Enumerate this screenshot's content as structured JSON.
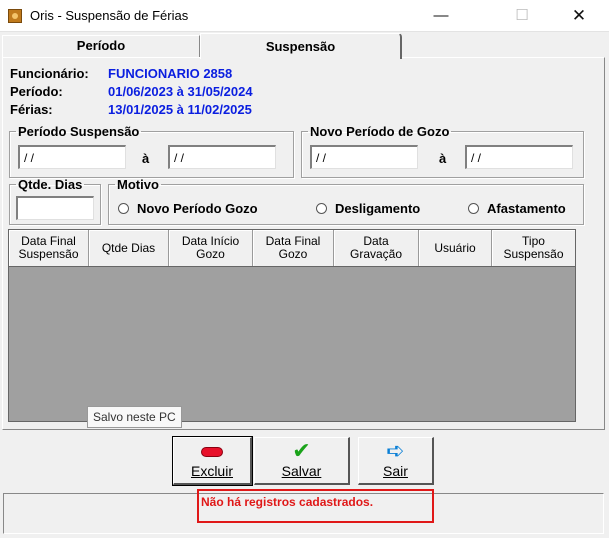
{
  "window": {
    "title": "Oris - Suspensão de Férias",
    "min_symbol": "—",
    "max_symbol": "☐",
    "close_symbol": "✕"
  },
  "tabs": [
    {
      "label": "Período"
    },
    {
      "label": "Suspensão"
    }
  ],
  "info": {
    "funcionario_label": "Funcionário:",
    "funcionario_value": "FUNCIONARIO 2858",
    "periodo_label": "Período:",
    "periodo_value": "01/06/2023 à 31/05/2024",
    "ferias_label": "Férias:",
    "ferias_value": "13/01/2025 à 11/02/2025"
  },
  "periodo_suspensao": {
    "legend": "Período Suspensão",
    "start_value": "/ /",
    "separator": "à",
    "end_value": "/ /"
  },
  "novo_periodo_gozo": {
    "legend": "Novo Período de Gozo",
    "start_value": "/ /",
    "separator": "à",
    "end_value": "/ /"
  },
  "qtde_dias": {
    "legend": "Qtde. Dias",
    "value": ""
  },
  "motivo": {
    "legend": "Motivo",
    "options": [
      {
        "label": "Novo Período Gozo"
      },
      {
        "label": "Desligamento"
      },
      {
        "label": "Afastamento"
      }
    ]
  },
  "grid": {
    "columns": [
      "Data Final\nSuspensão",
      "Qtde Dias",
      "Data Início\nGozo",
      "Data Final\nGozo",
      "Data\nGravação",
      "Usuário",
      "Tipo\nSuspensão"
    ],
    "rows": []
  },
  "tooltip": "Salvo neste PC",
  "buttons": {
    "excluir": "Excluir",
    "salvar": "Salvar",
    "sair": "Sair"
  },
  "status_message": "Não há registros cadastrados.",
  "colors": {
    "info_value": "#0a1ee0",
    "status_error": "#e01818",
    "check_icon": "#1aa31a",
    "arrow_icon": "#0a7fd6",
    "delete_icon": "#e8102a"
  }
}
